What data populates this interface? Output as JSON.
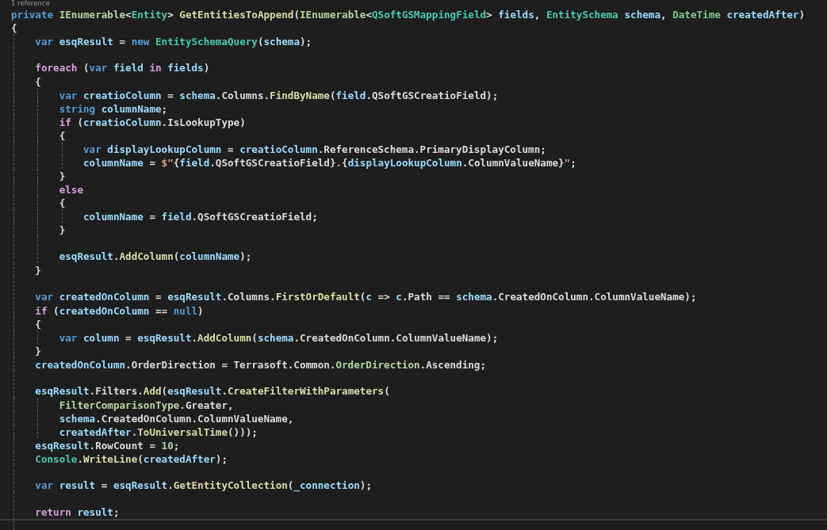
{
  "editor": {
    "codelens": "1 reference",
    "lines": [
      {
        "tokens": [
          {
            "kind": "keyword",
            "text": "private "
          },
          {
            "kind": "interface",
            "text": "IEnumerable"
          },
          {
            "kind": "plain",
            "text": "<"
          },
          {
            "kind": "type",
            "text": "Entity"
          },
          {
            "kind": "plain",
            "text": "> "
          },
          {
            "kind": "method",
            "text": "GetEntitiesToAppend"
          },
          {
            "kind": "plain",
            "text": "("
          },
          {
            "kind": "interface",
            "text": "IEnumerable"
          },
          {
            "kind": "plain",
            "text": "<"
          },
          {
            "kind": "type",
            "text": "QSoftGSMappingField"
          },
          {
            "kind": "plain",
            "text": "> "
          },
          {
            "kind": "variable",
            "text": "fields"
          },
          {
            "kind": "plain",
            "text": ", "
          },
          {
            "kind": "type",
            "text": "EntitySchema "
          },
          {
            "kind": "variable",
            "text": "schema"
          },
          {
            "kind": "plain",
            "text": ", "
          },
          {
            "kind": "struct",
            "text": "DateTime "
          },
          {
            "kind": "variable",
            "text": "createdAfter"
          },
          {
            "kind": "plain",
            "text": ")"
          }
        ]
      },
      {
        "tokens": [
          {
            "kind": "plain",
            "text": "{"
          }
        ]
      },
      {
        "tokens": [
          {
            "kind": "keyword",
            "text": "    var "
          },
          {
            "kind": "variable",
            "text": "esqResult"
          },
          {
            "kind": "plain",
            "text": " = "
          },
          {
            "kind": "keyword",
            "text": "new "
          },
          {
            "kind": "type",
            "text": "EntitySchemaQuery"
          },
          {
            "kind": "plain",
            "text": "("
          },
          {
            "kind": "variable",
            "text": "schema"
          },
          {
            "kind": "plain",
            "text": ");"
          }
        ]
      },
      {
        "gap_before": true,
        "tokens": [
          {
            "kind": "control",
            "text": "    foreach"
          },
          {
            "kind": "plain",
            "text": " ("
          },
          {
            "kind": "keyword",
            "text": "var "
          },
          {
            "kind": "variable",
            "text": "field"
          },
          {
            "kind": "control",
            "text": " in "
          },
          {
            "kind": "variable",
            "text": "fields"
          },
          {
            "kind": "plain",
            "text": ")"
          }
        ]
      },
      {
        "tokens": [
          {
            "kind": "plain",
            "text": "    {"
          }
        ]
      },
      {
        "tokens": [
          {
            "kind": "keyword",
            "text": "        var "
          },
          {
            "kind": "variable",
            "text": "creatioColumn"
          },
          {
            "kind": "plain",
            "text": " = "
          },
          {
            "kind": "variable",
            "text": "schema"
          },
          {
            "kind": "plain",
            "text": ".Columns."
          },
          {
            "kind": "method",
            "text": "FindByName"
          },
          {
            "kind": "plain",
            "text": "("
          },
          {
            "kind": "variable",
            "text": "field"
          },
          {
            "kind": "plain",
            "text": ".QSoftGSCreatioField);"
          }
        ]
      },
      {
        "tokens": [
          {
            "kind": "keyword",
            "text": "        string "
          },
          {
            "kind": "variable",
            "text": "columnName"
          },
          {
            "kind": "plain",
            "text": ";"
          }
        ]
      },
      {
        "tokens": [
          {
            "kind": "control",
            "text": "        if"
          },
          {
            "kind": "plain",
            "text": " ("
          },
          {
            "kind": "variable",
            "text": "creatioColumn"
          },
          {
            "kind": "plain",
            "text": ".IsLookupType)"
          }
        ]
      },
      {
        "tokens": [
          {
            "kind": "plain",
            "text": "        {"
          }
        ]
      },
      {
        "tokens": [
          {
            "kind": "keyword",
            "text": "            var "
          },
          {
            "kind": "variable",
            "text": "displayLookupColumn"
          },
          {
            "kind": "plain",
            "text": " = "
          },
          {
            "kind": "variable",
            "text": "creatioColumn"
          },
          {
            "kind": "plain",
            "text": ".ReferenceSchema.PrimaryDisplayColumn;"
          }
        ]
      },
      {
        "tokens": [
          {
            "kind": "variable",
            "text": "            columnName"
          },
          {
            "kind": "plain",
            "text": " = "
          },
          {
            "kind": "string",
            "text": "$\""
          },
          {
            "kind": "plain",
            "text": "{"
          },
          {
            "kind": "variable",
            "text": "field"
          },
          {
            "kind": "plain",
            "text": ".QSoftGSCreatioField}"
          },
          {
            "kind": "string",
            "text": "."
          },
          {
            "kind": "plain",
            "text": "{"
          },
          {
            "kind": "variable",
            "text": "displayLookupColumn"
          },
          {
            "kind": "plain",
            "text": ".ColumnValueName}"
          },
          {
            "kind": "string",
            "text": "\""
          },
          {
            "kind": "plain",
            "text": ";"
          }
        ]
      },
      {
        "tokens": [
          {
            "kind": "plain",
            "text": "        }"
          }
        ]
      },
      {
        "tokens": [
          {
            "kind": "control",
            "text": "        else"
          }
        ]
      },
      {
        "tokens": [
          {
            "kind": "plain",
            "text": "        {"
          }
        ]
      },
      {
        "tokens": [
          {
            "kind": "variable",
            "text": "            columnName"
          },
          {
            "kind": "plain",
            "text": " = "
          },
          {
            "kind": "variable",
            "text": "field"
          },
          {
            "kind": "plain",
            "text": ".QSoftGSCreatioField;"
          }
        ]
      },
      {
        "tokens": [
          {
            "kind": "plain",
            "text": "        }"
          }
        ]
      },
      {
        "gap_before": true,
        "tokens": [
          {
            "kind": "variable",
            "text": "        esqResult"
          },
          {
            "kind": "plain",
            "text": "."
          },
          {
            "kind": "method",
            "text": "AddColumn"
          },
          {
            "kind": "plain",
            "text": "("
          },
          {
            "kind": "variable",
            "text": "columnName"
          },
          {
            "kind": "plain",
            "text": ");"
          }
        ]
      },
      {
        "tokens": [
          {
            "kind": "plain",
            "text": "    }"
          }
        ]
      },
      {
        "gap_before": true,
        "tokens": [
          {
            "kind": "keyword",
            "text": "    var "
          },
          {
            "kind": "variable",
            "text": "createdOnColumn"
          },
          {
            "kind": "plain",
            "text": " = "
          },
          {
            "kind": "variable",
            "text": "esqResult"
          },
          {
            "kind": "plain",
            "text": ".Columns."
          },
          {
            "kind": "method",
            "text": "FirstOrDefault"
          },
          {
            "kind": "plain",
            "text": "("
          },
          {
            "kind": "variable",
            "text": "c"
          },
          {
            "kind": "plain",
            "text": " => "
          },
          {
            "kind": "variable",
            "text": "c"
          },
          {
            "kind": "plain",
            "text": ".Path == "
          },
          {
            "kind": "variable",
            "text": "schema"
          },
          {
            "kind": "plain",
            "text": ".CreatedOnColumn.ColumnValueName);"
          }
        ]
      },
      {
        "tokens": [
          {
            "kind": "control",
            "text": "    if"
          },
          {
            "kind": "plain",
            "text": " ("
          },
          {
            "kind": "variable",
            "text": "createdOnColumn"
          },
          {
            "kind": "plain",
            "text": " == "
          },
          {
            "kind": "keyword",
            "text": "null"
          },
          {
            "kind": "plain",
            "text": ")"
          }
        ]
      },
      {
        "tokens": [
          {
            "kind": "plain",
            "text": "    {"
          }
        ]
      },
      {
        "tokens": [
          {
            "kind": "keyword",
            "text": "        var "
          },
          {
            "kind": "variable",
            "text": "column"
          },
          {
            "kind": "plain",
            "text": " = "
          },
          {
            "kind": "variable",
            "text": "esqResult"
          },
          {
            "kind": "plain",
            "text": "."
          },
          {
            "kind": "method",
            "text": "AddColumn"
          },
          {
            "kind": "plain",
            "text": "("
          },
          {
            "kind": "variable",
            "text": "schema"
          },
          {
            "kind": "plain",
            "text": ".CreatedOnColumn.ColumnValueName);"
          }
        ]
      },
      {
        "tokens": [
          {
            "kind": "plain",
            "text": "    }"
          }
        ]
      },
      {
        "tokens": [
          {
            "kind": "variable",
            "text": "    createdOnColumn"
          },
          {
            "kind": "plain",
            "text": ".OrderDirection = Terrasoft.Common."
          },
          {
            "kind": "enum",
            "text": "OrderDirection"
          },
          {
            "kind": "plain",
            "text": ".Ascending;"
          }
        ]
      },
      {
        "gap_before": true,
        "tokens": [
          {
            "kind": "variable",
            "text": "    esqResult"
          },
          {
            "kind": "plain",
            "text": ".Filters."
          },
          {
            "kind": "method",
            "text": "Add"
          },
          {
            "kind": "plain",
            "text": "("
          },
          {
            "kind": "variable",
            "text": "esqResult"
          },
          {
            "kind": "plain",
            "text": "."
          },
          {
            "kind": "method",
            "text": "CreateFilterWithParameters"
          },
          {
            "kind": "plain",
            "text": "("
          }
        ]
      },
      {
        "tokens": [
          {
            "kind": "enum",
            "text": "        FilterComparisonType"
          },
          {
            "kind": "plain",
            "text": ".Greater,"
          }
        ]
      },
      {
        "tokens": [
          {
            "kind": "variable",
            "text": "        schema"
          },
          {
            "kind": "plain",
            "text": ".CreatedOnColumn.ColumnValueName,"
          }
        ]
      },
      {
        "tokens": [
          {
            "kind": "variable",
            "text": "        createdAfter"
          },
          {
            "kind": "plain",
            "text": "."
          },
          {
            "kind": "method",
            "text": "ToUniversalTime"
          },
          {
            "kind": "plain",
            "text": "()));"
          }
        ]
      },
      {
        "tokens": [
          {
            "kind": "variable",
            "text": "    esqResult"
          },
          {
            "kind": "plain",
            "text": ".RowCount = "
          },
          {
            "kind": "number",
            "text": "10"
          },
          {
            "kind": "plain",
            "text": ";"
          }
        ]
      },
      {
        "tokens": [
          {
            "kind": "type",
            "text": "    Console"
          },
          {
            "kind": "plain",
            "text": "."
          },
          {
            "kind": "method",
            "text": "WriteLine"
          },
          {
            "kind": "plain",
            "text": "("
          },
          {
            "kind": "variable",
            "text": "createdAfter"
          },
          {
            "kind": "plain",
            "text": ");"
          }
        ]
      },
      {
        "gap_before": true,
        "tokens": [
          {
            "kind": "keyword",
            "text": "    var "
          },
          {
            "kind": "variable",
            "text": "result"
          },
          {
            "kind": "plain",
            "text": " = "
          },
          {
            "kind": "variable",
            "text": "esqResult"
          },
          {
            "kind": "plain",
            "text": "."
          },
          {
            "kind": "method",
            "text": "GetEntityCollection"
          },
          {
            "kind": "plain",
            "text": "("
          },
          {
            "kind": "variable",
            "text": "_connection"
          },
          {
            "kind": "plain",
            "text": ");"
          }
        ]
      },
      {
        "gap_before": true,
        "tokens": [
          {
            "kind": "control",
            "text": "    return "
          },
          {
            "kind": "variable",
            "text": "result"
          },
          {
            "kind": "plain",
            "text": ";"
          }
        ]
      }
    ]
  }
}
